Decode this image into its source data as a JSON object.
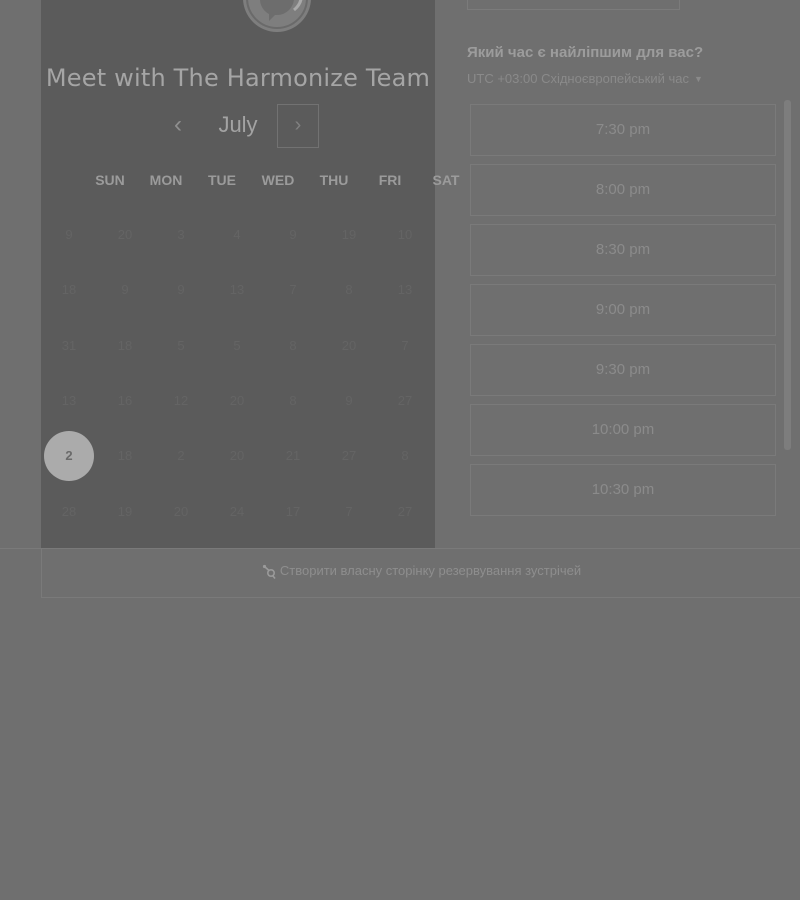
{
  "calendar": {
    "title": "Meet with The Harmonize Team",
    "month": "July",
    "prev_glyph": "‹",
    "next_glyph": "›",
    "weekdays": [
      "SUN",
      "MON",
      "TUE",
      "WED",
      "THU",
      "FRI",
      "SAT"
    ],
    "weeks": [
      [
        "9",
        "20",
        "3",
        "4",
        "9",
        "19",
        "10"
      ],
      [
        "18",
        "9",
        "9",
        "13",
        "7",
        "8",
        "13"
      ],
      [
        "31",
        "18",
        "5",
        "5",
        "8",
        "20",
        "7"
      ],
      [
        "13",
        "16",
        "12",
        "20",
        "8",
        "9",
        "27"
      ],
      [
        "2",
        "18",
        "2",
        "20",
        "21",
        "27",
        "8"
      ],
      [
        "28",
        "19",
        "20",
        "24",
        "17",
        "7",
        "27"
      ]
    ],
    "selected_day": "2"
  },
  "booking": {
    "question": "Який час є найліпшим для вас?",
    "timezone": "UTC +03:00 Східноєвропейський час",
    "timezone_caret": "▼",
    "time_slots": [
      "7:30 pm",
      "8:00 pm",
      "8:30 pm",
      "9:00 pm",
      "9:30 pm",
      "10:00 pm",
      "10:30 pm"
    ]
  },
  "footer": {
    "link_text": "Створити власну сторінку резервування зустрічей"
  },
  "colors": {
    "background": "#6f6f6f",
    "panel": "#5b5b5b",
    "selected_day": "#ababab"
  }
}
